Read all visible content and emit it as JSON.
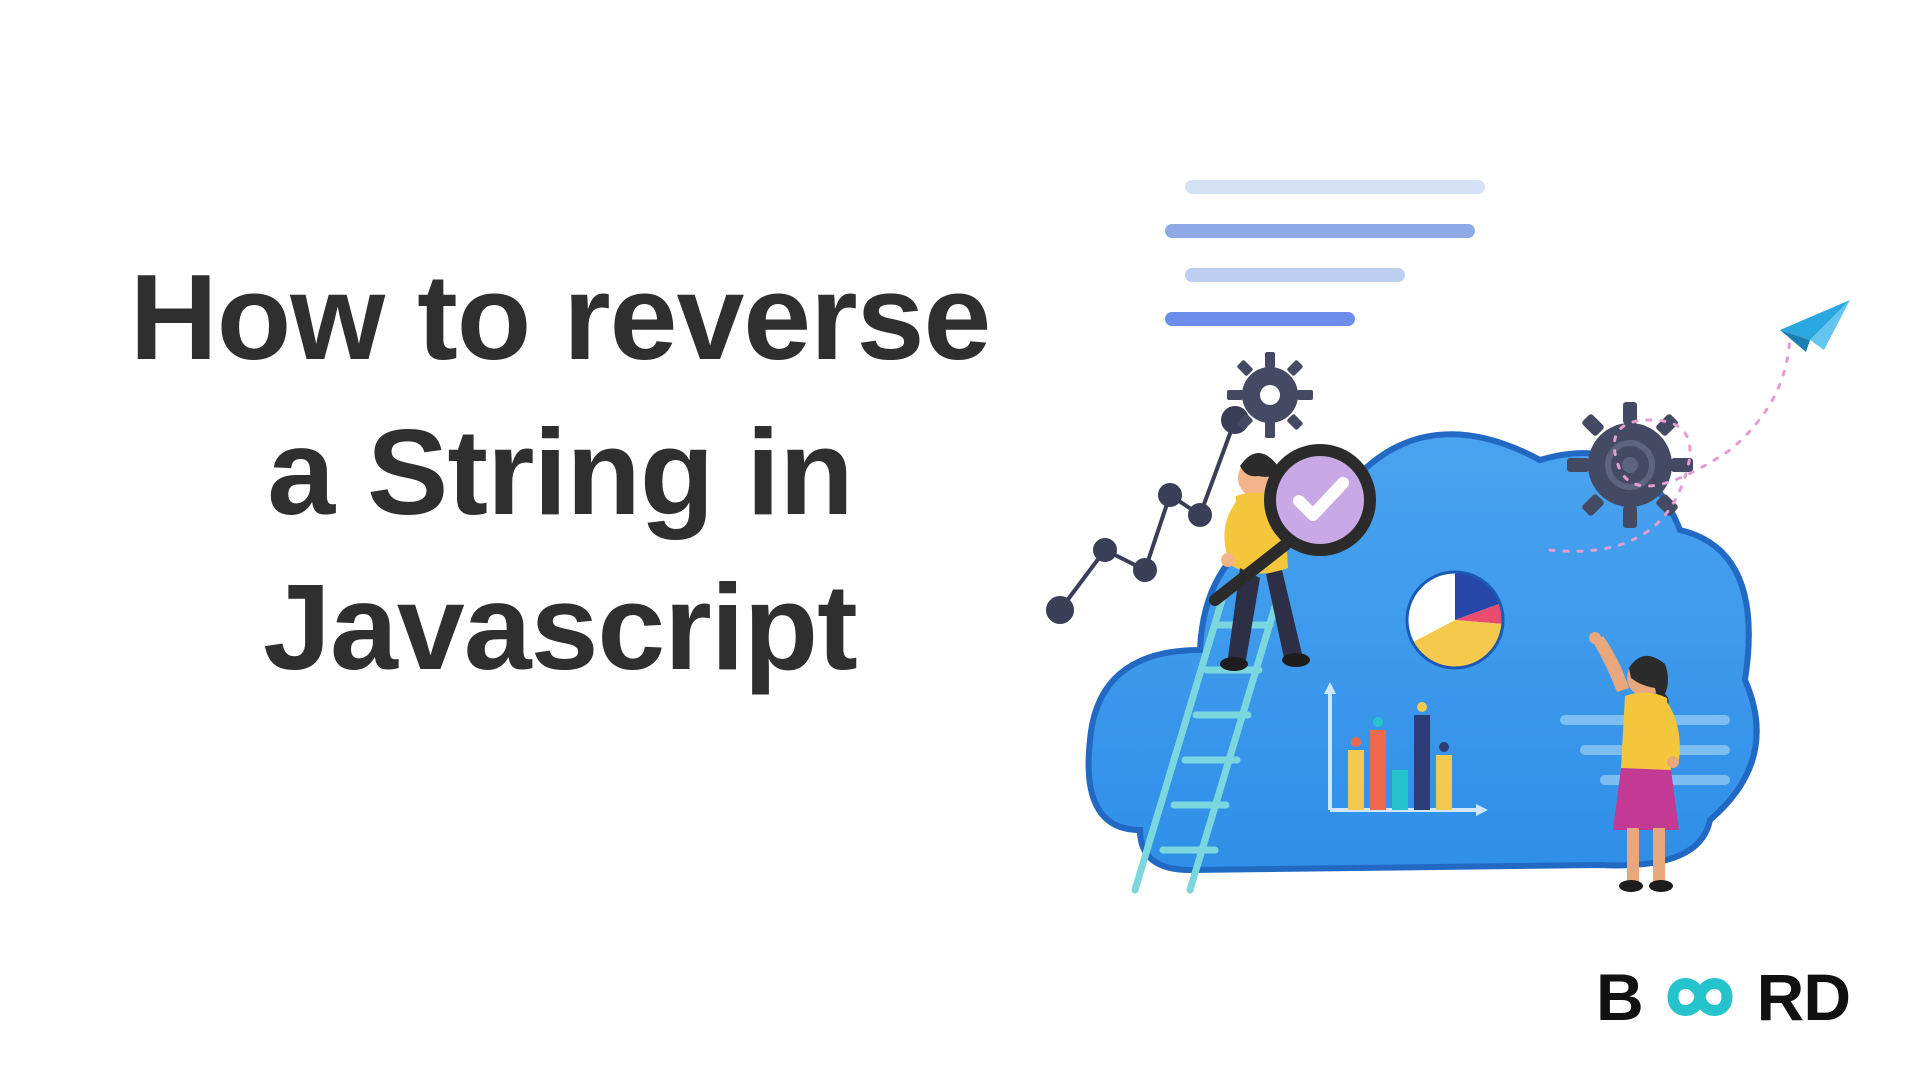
{
  "title": {
    "line1": "How to reverse",
    "line2": "a String in",
    "line3": "Javascript"
  },
  "logo": {
    "left": "B",
    "right": "RD",
    "name": "BOARD"
  },
  "illustration": {
    "alt": "Cloud analytics illustration with two people, charts, gears, ladder and paper plane",
    "icons": {
      "cloud": "cloud-icon",
      "gear": "gear-icon",
      "magnifier": "magnifier-icon",
      "pie": "pie-chart-icon",
      "bar": "bar-chart-icon",
      "ladder": "ladder-icon",
      "plane": "paper-plane-icon",
      "graph": "node-graph-icon"
    }
  },
  "colors": {
    "text": "#2f2f2f",
    "cloud_fill": "#2f8fe8",
    "cloud_dark": "#2269c4",
    "accent_yellow": "#f6c445",
    "accent_pink": "#d247a1",
    "accent_teal": "#25c3cc",
    "gear": "#444a64"
  }
}
